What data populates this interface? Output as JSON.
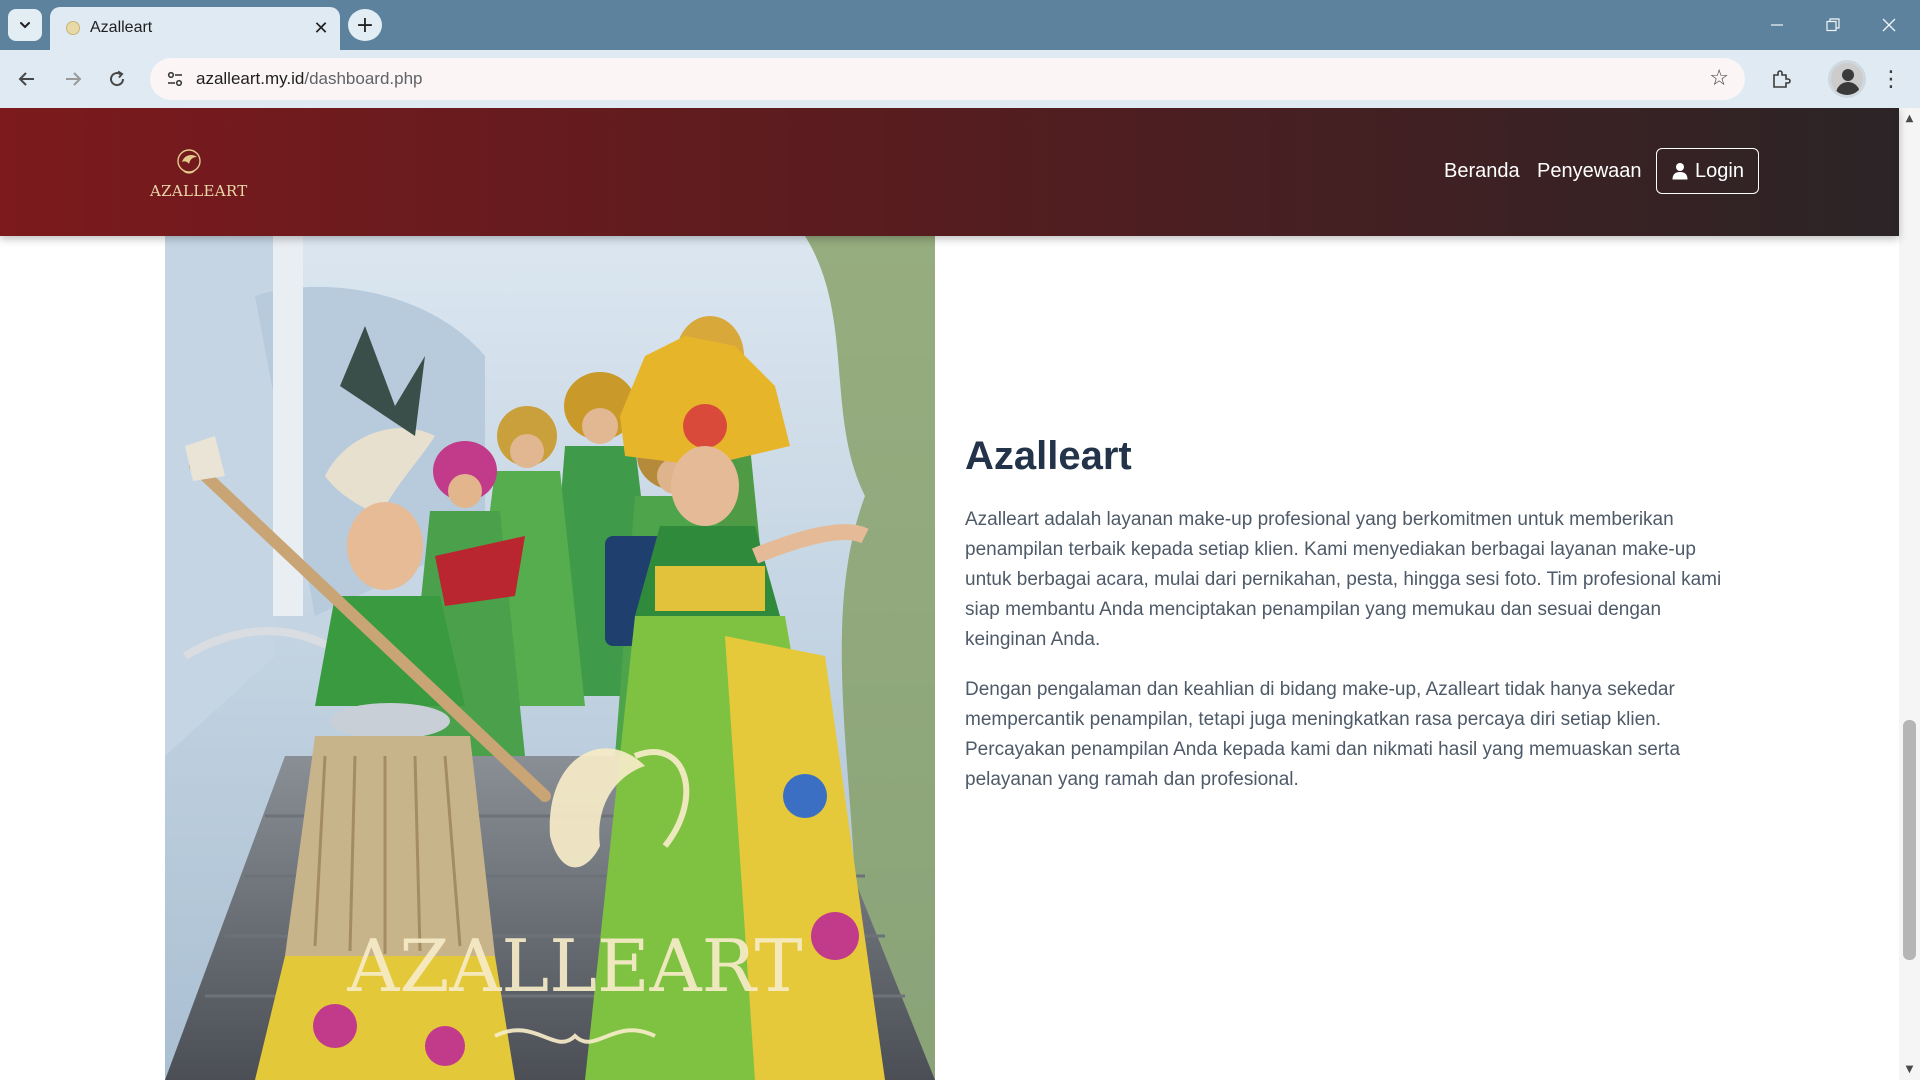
{
  "browser": {
    "tab_title": "Azalleart",
    "url_host": "azalleart.my.id",
    "url_path": "/dashboard.php"
  },
  "site": {
    "brand": "AZALLEART",
    "nav": {
      "home": "Beranda",
      "rental": "Penyewaan",
      "login": "Login"
    }
  },
  "hero": {
    "watermark": "AZALLEART"
  },
  "about": {
    "title": "Azalleart",
    "paragraph_1": "Azalleart adalah layanan make-up profesional yang berkomitmen untuk memberikan penampilan terbaik kepada setiap klien. Kami menyediakan berbagai layanan make-up untuk berbagai acara, mulai dari pernikahan, pesta, hingga sesi foto. Tim profesional kami siap membantu Anda menciptakan penampilan yang memukau dan sesuai dengan keinginan Anda.",
    "paragraph_2": "Dengan pengalaman dan keahlian di bidang make-up, Azalleart tidak hanya sekedar mempercantik penampilan, tetapi juga meningkatkan rasa percaya diri setiap klien. Percayakan penampilan Anda kepada kami dan nikmati hasil yang memuaskan serta pelayanan yang ramah dan profesional."
  },
  "colors": {
    "header_start": "#7c1a1d",
    "header_end": "#2b2426",
    "title": "#23344a",
    "body_text": "#4e5a68",
    "browser_frame": "#5d829e"
  }
}
